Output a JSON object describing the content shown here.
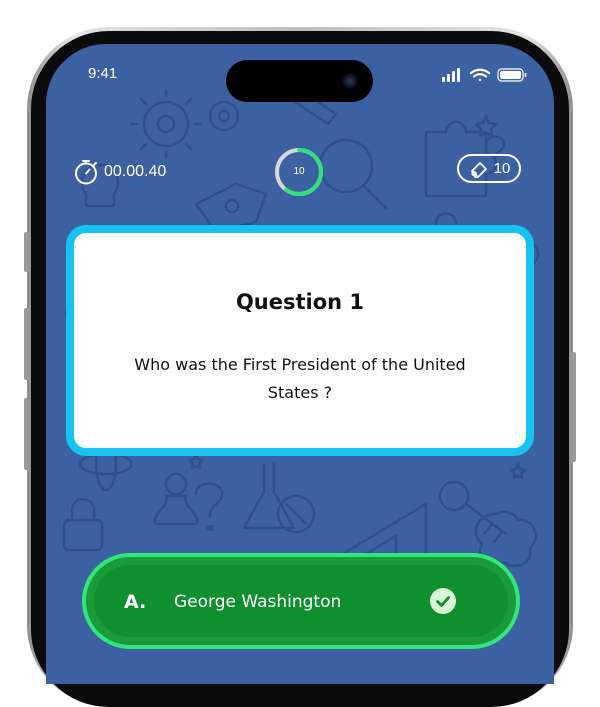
{
  "status_bar": {
    "time": "9:41"
  },
  "game": {
    "timer": "00.00.40",
    "progress_count": "10",
    "progress_fraction": 0.6,
    "hints_count": "10"
  },
  "question": {
    "title": "Question 1",
    "text": "Who was the First President of the United States ?"
  },
  "answer": {
    "letter": "A.",
    "text": "George Washington",
    "state": "correct"
  },
  "colors": {
    "background": "#3c61a3",
    "card_border": "#16c3f0",
    "answer_fill": "#0f8f2d",
    "answer_border": "#33e57a",
    "progress_active": "#2fe07b"
  },
  "icons": [
    "stopwatch-icon",
    "eraser-icon",
    "check-circle-icon",
    "signal-icon",
    "wifi-icon",
    "battery-icon"
  ]
}
